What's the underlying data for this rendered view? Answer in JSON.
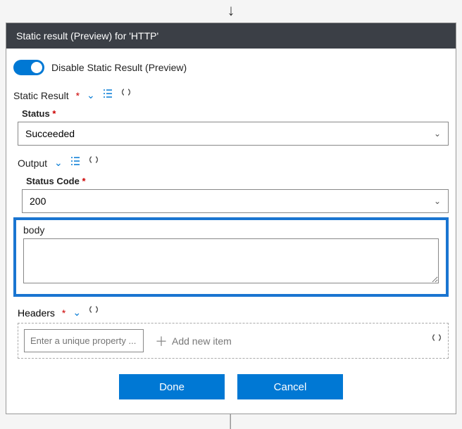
{
  "arrowGlyph": "↓",
  "header": {
    "title": "Static result (Preview) for 'HTTP'"
  },
  "toggle": {
    "label": "Disable Static Result (Preview)",
    "on": true
  },
  "staticResult": {
    "label": "Static Result",
    "required": "*"
  },
  "chevronGlyph": "⌄",
  "listIconGlyph": "⋮≡",
  "status": {
    "label": "Status",
    "required": "*",
    "value": "Succeeded"
  },
  "output": {
    "label": "Output",
    "statusCode": {
      "label": "Status Code",
      "required": "*",
      "value": "200"
    },
    "body": {
      "label": "body",
      "value": ""
    },
    "headers": {
      "label": "Headers",
      "required": "*",
      "propertyPlaceholder": "Enter a unique property ...",
      "addItemLabel": "Add new item"
    }
  },
  "buttons": {
    "done": "Done",
    "cancel": "Cancel"
  }
}
